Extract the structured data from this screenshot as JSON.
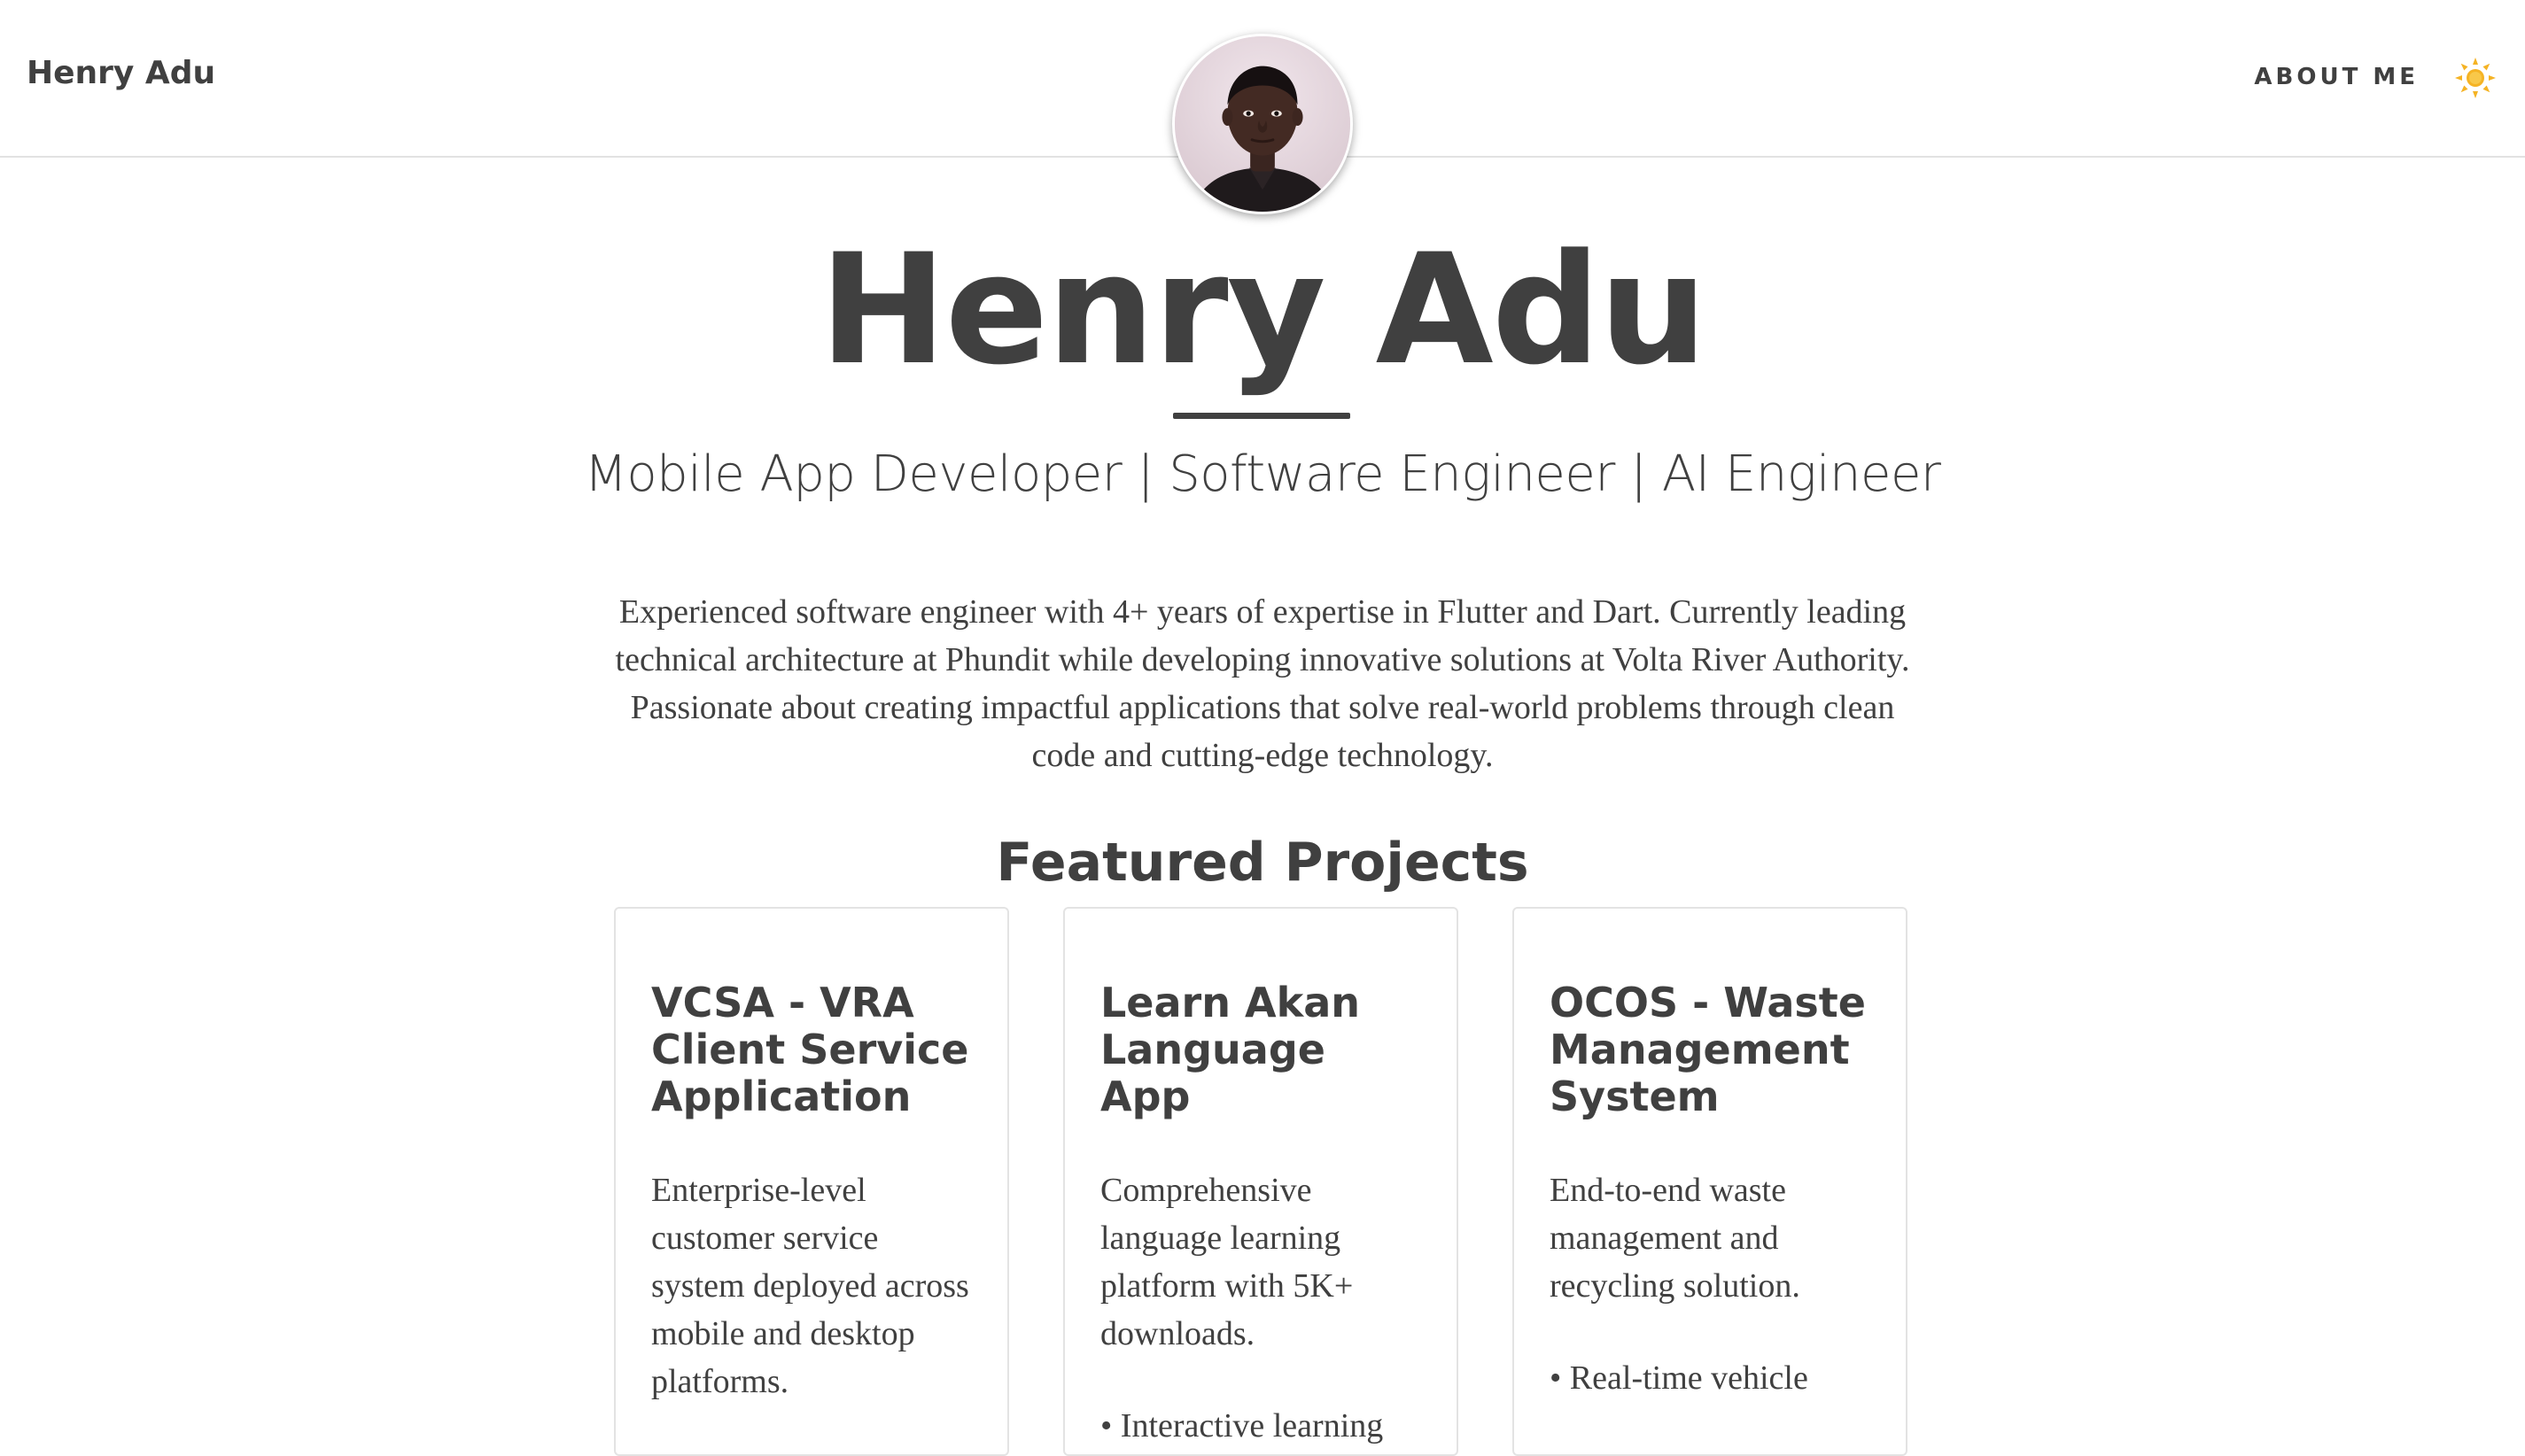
{
  "header": {
    "brand": "Henry Adu",
    "nav": {
      "about_label": "ABOUT ME"
    },
    "theme_toggle_icon": "sun-icon"
  },
  "hero": {
    "avatar_icon": "profile-photo",
    "name": "Henry Adu",
    "tagline": "Mobile App Developer | Software Engineer | AI Engineer",
    "bio": "Experienced software engineer with 4+ years of expertise in Flutter and Dart. Currently leading technical architecture at Phundit while developing innovative solutions at Volta River Authority. Passionate about creating impactful applications that solve real-world problems through clean code and cutting-edge technology."
  },
  "featured": {
    "title": "Featured Projects",
    "projects": [
      {
        "title": "VCSA - VRA Client Service Application",
        "description": "Enterprise-level customer service system deployed across mobile and desktop platforms.",
        "feature_peek": ""
      },
      {
        "title": "Learn Akan Language App",
        "description": "Comprehensive language learning platform with 5K+ downloads.",
        "feature_peek": "• Interactive learning"
      },
      {
        "title": "OCOS - Waste Management System",
        "description": "End-to-end waste management and recycling solution.",
        "feature_peek": "• Real-time vehicle"
      }
    ]
  },
  "colors": {
    "text": "#404040",
    "border": "#e3e3e3",
    "sun": "#f5b324",
    "background": "#ffffff"
  }
}
